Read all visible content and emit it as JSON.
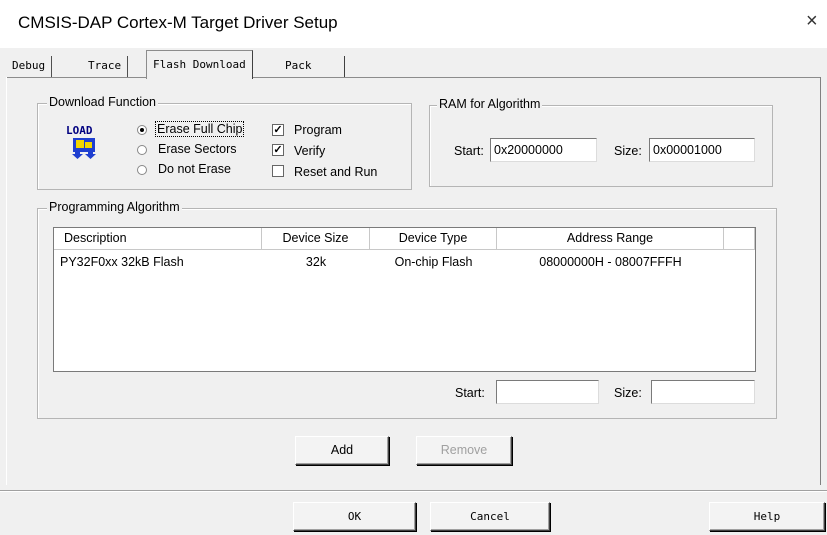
{
  "window": {
    "title": "CMSIS-DAP Cortex-M Target Driver Setup",
    "close_glyph": "×"
  },
  "tabs": [
    {
      "label": "Debug",
      "active": false
    },
    {
      "label": "Trace",
      "active": false
    },
    {
      "label": "Flash Download",
      "active": true
    },
    {
      "label": "Pack",
      "active": false
    }
  ],
  "download_function": {
    "legend": "Download Function",
    "logo_text": "LOAD",
    "radios": [
      {
        "label": "Erase Full Chip",
        "checked": true
      },
      {
        "label": "Erase Sectors",
        "checked": false
      },
      {
        "label": "Do not Erase",
        "checked": false
      }
    ],
    "checkboxes": [
      {
        "label": "Program",
        "checked": true
      },
      {
        "label": "Verify",
        "checked": true
      },
      {
        "label": "Reset and Run",
        "checked": false
      }
    ],
    "check_glyph": "✓"
  },
  "ram_for_algorithm": {
    "legend": "RAM for Algorithm",
    "start_label": "Start:",
    "start_value": "0x20000000",
    "size_label": "Size:",
    "size_value": "0x00001000"
  },
  "programming_algorithm": {
    "legend": "Programming Algorithm",
    "columns": [
      "Description",
      "Device Size",
      "Device Type",
      "Address Range"
    ],
    "rows": [
      {
        "description": "PY32F0xx 32kB Flash",
        "device_size": "32k",
        "device_type": "On-chip Flash",
        "address_range": "08000000H - 08007FFFH"
      }
    ],
    "start_label": "Start:",
    "start_value": "",
    "size_label": "Size:",
    "size_value": ""
  },
  "buttons": {
    "add": "Add",
    "remove": "Remove",
    "ok": "OK",
    "cancel": "Cancel",
    "help": "Help"
  },
  "colors": {
    "logo_blue": "#1f3fd0",
    "logo_yellow": "#f2d600",
    "logo_text": "#000080"
  }
}
